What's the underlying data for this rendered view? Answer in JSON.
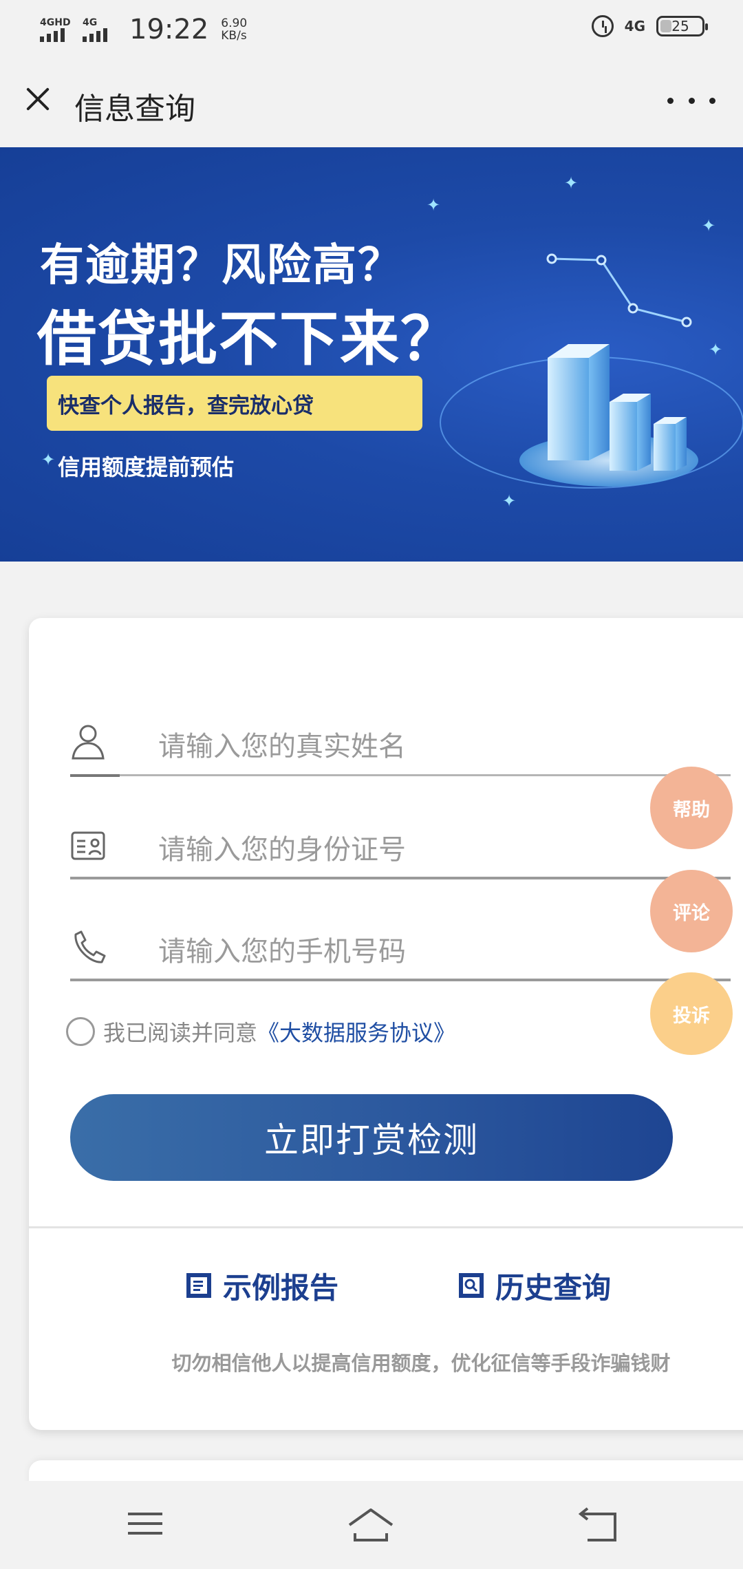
{
  "status_bar": {
    "network_1": "4GHD",
    "network_2": "4G",
    "time": "19:22",
    "speed_value": "6.90",
    "speed_unit": "KB/s",
    "right_network": "4G",
    "battery": "25"
  },
  "nav": {
    "title": "信息查询"
  },
  "banner": {
    "line1": "有逾期？风险高？",
    "line2": "借贷批不下来？",
    "pill": "快查个人报告，查完放心贷",
    "sub": "信用额度提前预估"
  },
  "form": {
    "name_placeholder": "请输入您的真实姓名",
    "id_placeholder": "请输入您的身份证号",
    "phone_placeholder": "请输入您的手机号码",
    "agree_text": "我已阅读并同意",
    "agree_link": "《大数据服务协议》",
    "submit_label": "立即打赏检测"
  },
  "links": {
    "sample_report": "示例报告",
    "history_query": "历史查询"
  },
  "notice": "切勿相信他人以提高信用额度，优化征信等手段诈骗钱财",
  "fabs": {
    "help": "帮助",
    "comment": "评论",
    "report": "投诉"
  },
  "colors": {
    "banner_bg": "#1d4aa8",
    "pill_bg": "#f7e27c",
    "submit_start": "#3a6ea8",
    "submit_end": "#1e4592",
    "link_color": "#1c3f8f",
    "fab_help": "#f3b496",
    "fab_report": "#fbcf8a"
  },
  "icons": {
    "close": "close-icon",
    "more": "more-icon",
    "user": "user-icon",
    "id_card": "id-card-icon",
    "phone": "phone-icon",
    "report": "report-icon",
    "history": "history-icon"
  }
}
